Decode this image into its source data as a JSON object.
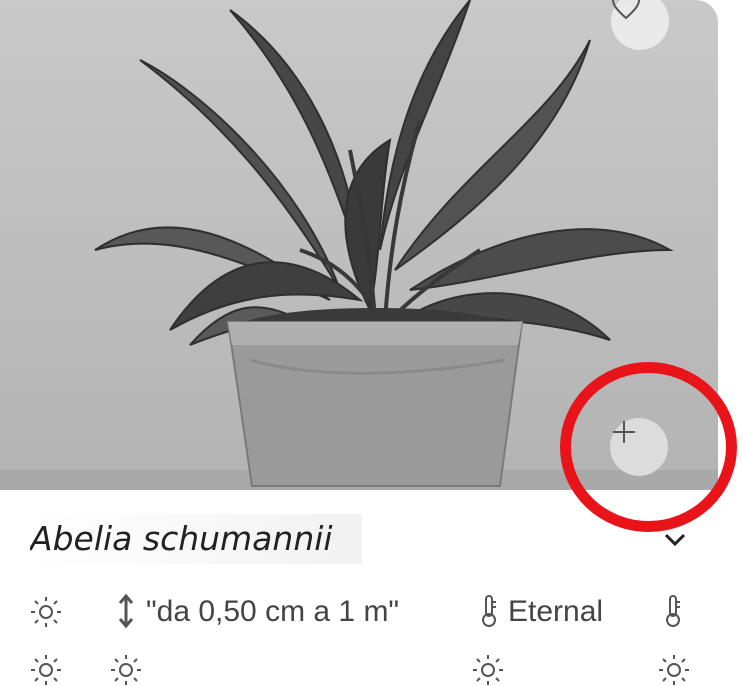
{
  "plant": {
    "name": "Abelia schumannii",
    "height": "\"da 0,50 cm a 1 m\"",
    "temperature": "Eternal"
  },
  "icons": {
    "favorite": "heart-icon",
    "add": "plus-icon",
    "sun": "sun-icon",
    "height": "height-arrow-icon",
    "temperature": "thermometer-icon",
    "expand": "chevron-down-icon"
  },
  "colors": {
    "highlight": "#e8141a",
    "text": "#444444"
  }
}
